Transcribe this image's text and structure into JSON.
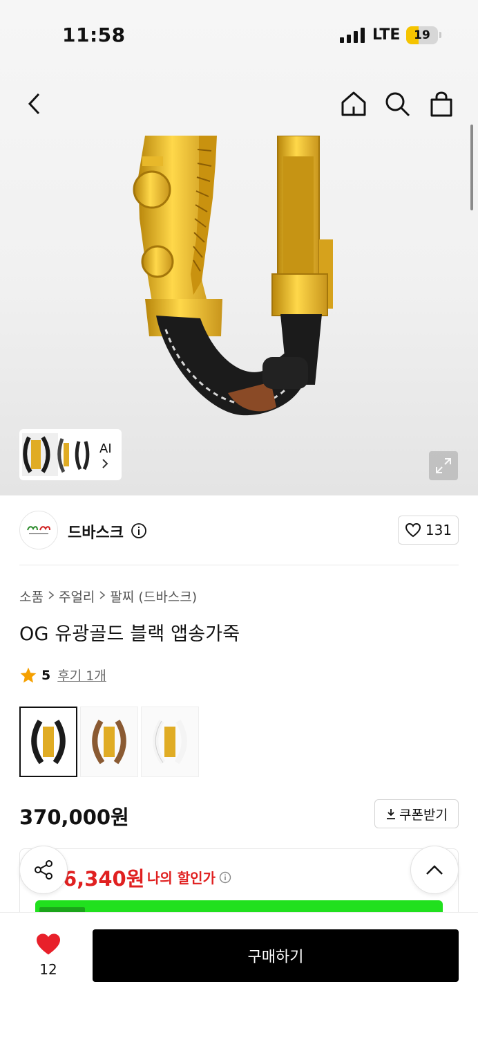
{
  "status_bar": {
    "time": "11:58",
    "network": "LTE",
    "battery": "19"
  },
  "nav": {
    "back_icon": "chevron-left-icon",
    "home_icon": "home-icon",
    "search_icon": "search-icon",
    "cart_icon": "shopping-bag-icon"
  },
  "gallery": {
    "ai_label": "AI"
  },
  "brand": {
    "name": "드바스크",
    "likes": "131"
  },
  "breadcrumb": [
    "소품",
    "주얼리",
    "팔찌 (드바스크)"
  ],
  "product": {
    "title": "OG 유광골드 블랙 앱송가죽",
    "rating": "5",
    "reviews_label": "후기 1개",
    "variants": [
      {
        "strap_color": "#1b1b1b"
      },
      {
        "strap_color": "#8a5a32"
      },
      {
        "strap_color": "#f4f4f4"
      }
    ],
    "price": "370,000원",
    "coupon_label": "쿠폰받기"
  },
  "discount": {
    "price": "6,340원",
    "label": "나의 할인가"
  },
  "bottom": {
    "wish_count": "12",
    "buy_label": "구매하기"
  },
  "colors": {
    "accent_red": "#e02020",
    "green_banner": "#21e01e",
    "gold": "#d9a520"
  }
}
